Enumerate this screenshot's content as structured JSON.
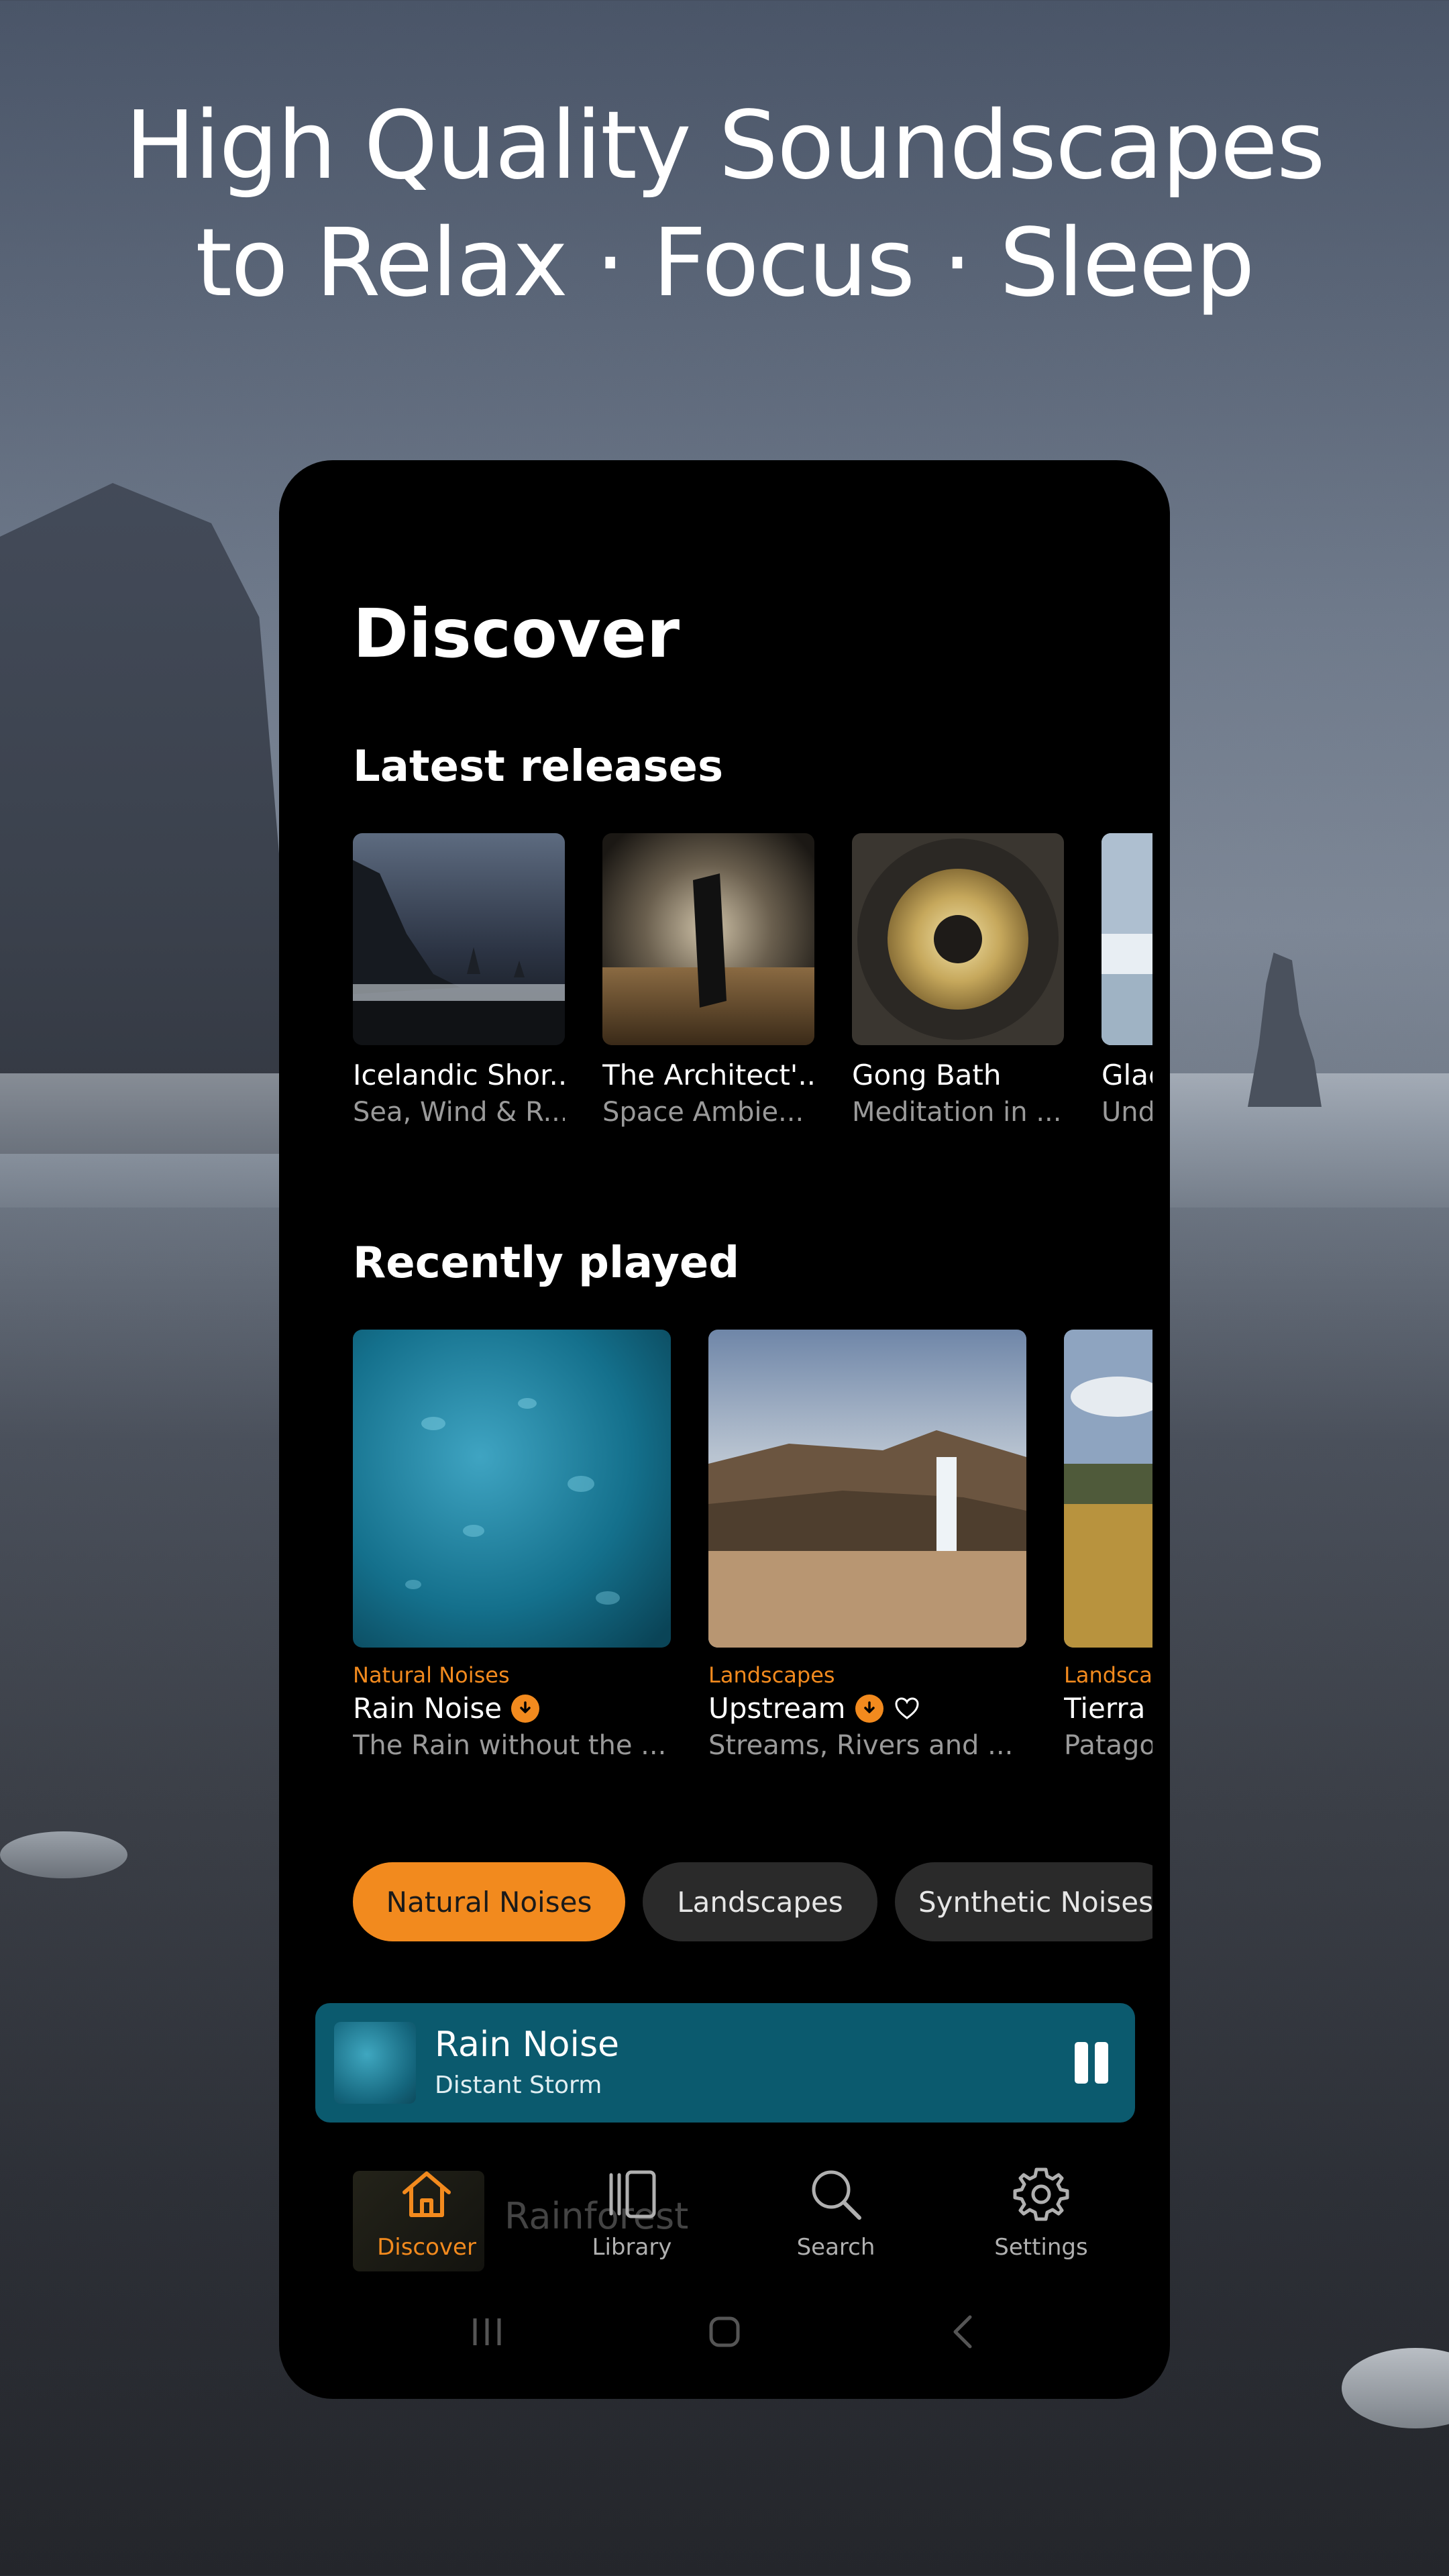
{
  "headline": {
    "line1": "High Quality Soundscapes",
    "line2": "to Relax · Focus · Sleep"
  },
  "app": {
    "title": "Discover",
    "latest": {
      "heading": "Latest releases",
      "items": [
        {
          "title": "Icelandic Shor...",
          "subtitle": "Sea, Wind & R..."
        },
        {
          "title": "The Architect'...",
          "subtitle": "Space Ambie..."
        },
        {
          "title": "Gong Bath",
          "subtitle": "Meditation in ..."
        },
        {
          "title": "Glac",
          "subtitle": "Und"
        }
      ]
    },
    "recent": {
      "heading": "Recently played",
      "items": [
        {
          "category": "Natural Noises",
          "title": "Rain Noise",
          "subtitle": "The Rain without the ...",
          "downloaded": true,
          "favorite_icon": false
        },
        {
          "category": "Landscapes",
          "title": "Upstream",
          "subtitle": "Streams, Rivers and ...",
          "downloaded": true,
          "favorite_icon": true
        },
        {
          "category": "Landsca",
          "title": "Tierra",
          "subtitle": "Patago",
          "downloaded": false,
          "favorite_icon": false
        }
      ]
    },
    "chips": [
      {
        "label": "Natural Noises",
        "active": true
      },
      {
        "label": "Landscapes",
        "active": false
      },
      {
        "label": "Synthetic Noises",
        "active": false
      }
    ],
    "list_peek": {
      "text": "Rainforest"
    },
    "now_playing": {
      "title": "Rain Noise",
      "subtitle": "Distant Storm",
      "state": "playing"
    },
    "tabs": [
      {
        "label": "Discover",
        "icon": "home-icon",
        "active": true
      },
      {
        "label": "Library",
        "icon": "library-icon",
        "active": false
      },
      {
        "label": "Search",
        "icon": "search-icon",
        "active": false
      },
      {
        "label": "Settings",
        "icon": "gear-icon",
        "active": false
      }
    ],
    "colors": {
      "accent": "#f28a1e",
      "player": "#0b5a6e",
      "background": "#000000"
    }
  }
}
